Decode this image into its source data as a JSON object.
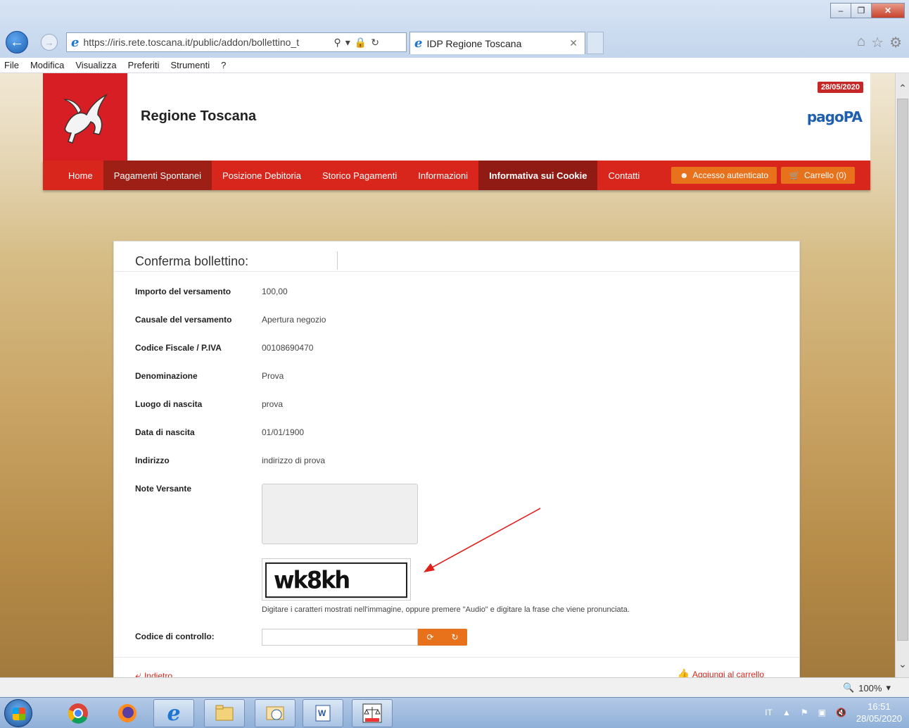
{
  "browser": {
    "url": "https://iris.rete.toscana.it/public/addon/bollettino_t",
    "url_host": "toscana.it",
    "tab_title": "IDP Regione Toscana",
    "menu": [
      "File",
      "Modifica",
      "Visualizza",
      "Preferiti",
      "Strumenti",
      "?"
    ],
    "zoom": "100%"
  },
  "site": {
    "title": "Regione Toscana",
    "date": "28/05/2020",
    "brand": "pagoPA",
    "accent_color": "#d8261c",
    "nav": [
      {
        "label": "Home"
      },
      {
        "label": "Pagamenti Spontanei"
      },
      {
        "label": "Posizione Debitoria"
      },
      {
        "label": "Storico Pagamenti"
      },
      {
        "label": "Informazioni"
      },
      {
        "label": "Informativa sui Cookie"
      },
      {
        "label": "Contatti"
      }
    ],
    "login_button": "Accesso autenticato",
    "cart_button": "Carrello (0)"
  },
  "form": {
    "title": "Conferma bollettino:",
    "fields": [
      {
        "label": "Importo del versamento",
        "value": "100,00"
      },
      {
        "label": "Causale del versamento",
        "value": "Apertura negozio"
      },
      {
        "label": "Codice Fiscale / P.IVA",
        "value": "00108690470"
      },
      {
        "label": "Denominazione",
        "value": "Prova"
      },
      {
        "label": "Luogo di nascita",
        "value": "prova"
      },
      {
        "label": "Data di nascita",
        "value": "01/01/1900"
      },
      {
        "label": "Indirizzo",
        "value": "indirizzo di prova"
      },
      {
        "label": "Note Versante",
        "value": ""
      }
    ],
    "captcha_text": "wk8kh",
    "captcha_hint": "Digitare i caratteri mostrati nell'immagine, oppure premere \"Audio\" e digitare la frase che viene pronunciata.",
    "code_label": "Codice di controllo:",
    "back_link": "Indietro",
    "add_link": "Aggiungi al carrello"
  },
  "taskbar": {
    "lang": "IT",
    "time": "16:51",
    "date": "28/05/2020"
  }
}
